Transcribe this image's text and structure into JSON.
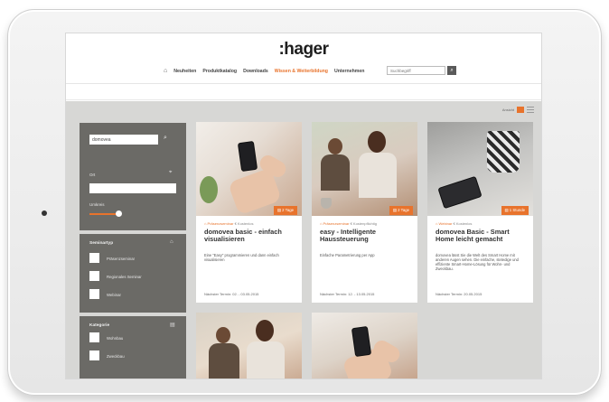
{
  "header": {
    "logo_text": "hager",
    "nav": [
      "Neuheiten",
      "Produktkatalog",
      "Downloads",
      "Wissen & Weiterbildung",
      "Unternehmen"
    ],
    "active_nav": "Wissen & Weiterbildung",
    "search_placeholder": "Suchbegriff"
  },
  "viewbar": {
    "label": "Ansicht"
  },
  "sidebar": {
    "search_value": "domovea",
    "ort_label": "Ort",
    "umkreis_label": "Umkreis",
    "section1_title": "Seminartyp",
    "section1_options": [
      "Präsenzseminar",
      "Regionales Seminar",
      "Webinar"
    ],
    "section2_title": "Kategorie",
    "section2_options": [
      "Wohnbau",
      "Zweckbau"
    ]
  },
  "cards": [
    {
      "badge": "2 Tage",
      "type": "Präsenzseminar",
      "cost": "€ Kostenlos",
      "title": "domovea basic - einfach visualisieren",
      "desc": "Eine \"Easy\" programmieren und dann einfach visualisieren",
      "date": "Nächster Termin: 02. - 03.05.2015"
    },
    {
      "badge": "2 Tage",
      "type": "Präsenzseminar",
      "cost": "€ Kostenpflichtig",
      "title": "easy - Intelligente Haussteuerung",
      "desc": "Einfache Parametrierung per App",
      "date": "Nächster Termin: 12. - 13.05.2015"
    },
    {
      "badge": "1 Stunde",
      "type": "Webinar",
      "cost": "€ Kostenlos",
      "title": "domovea Basic - Smart Home leicht gemacht",
      "desc": "domovea lässt Sie die Welt des Smart Home mit anderen Augen sehen. Die einfache, stetedige und effiziente Smart-Home-Lösung für Wohn- und Zweckbau.",
      "date": "Nächster Termin: 20.05.2015"
    }
  ],
  "colors": {
    "accent": "#e8732c",
    "sidebar": "#6b6a66",
    "content_bg": "#d7d7d5"
  }
}
